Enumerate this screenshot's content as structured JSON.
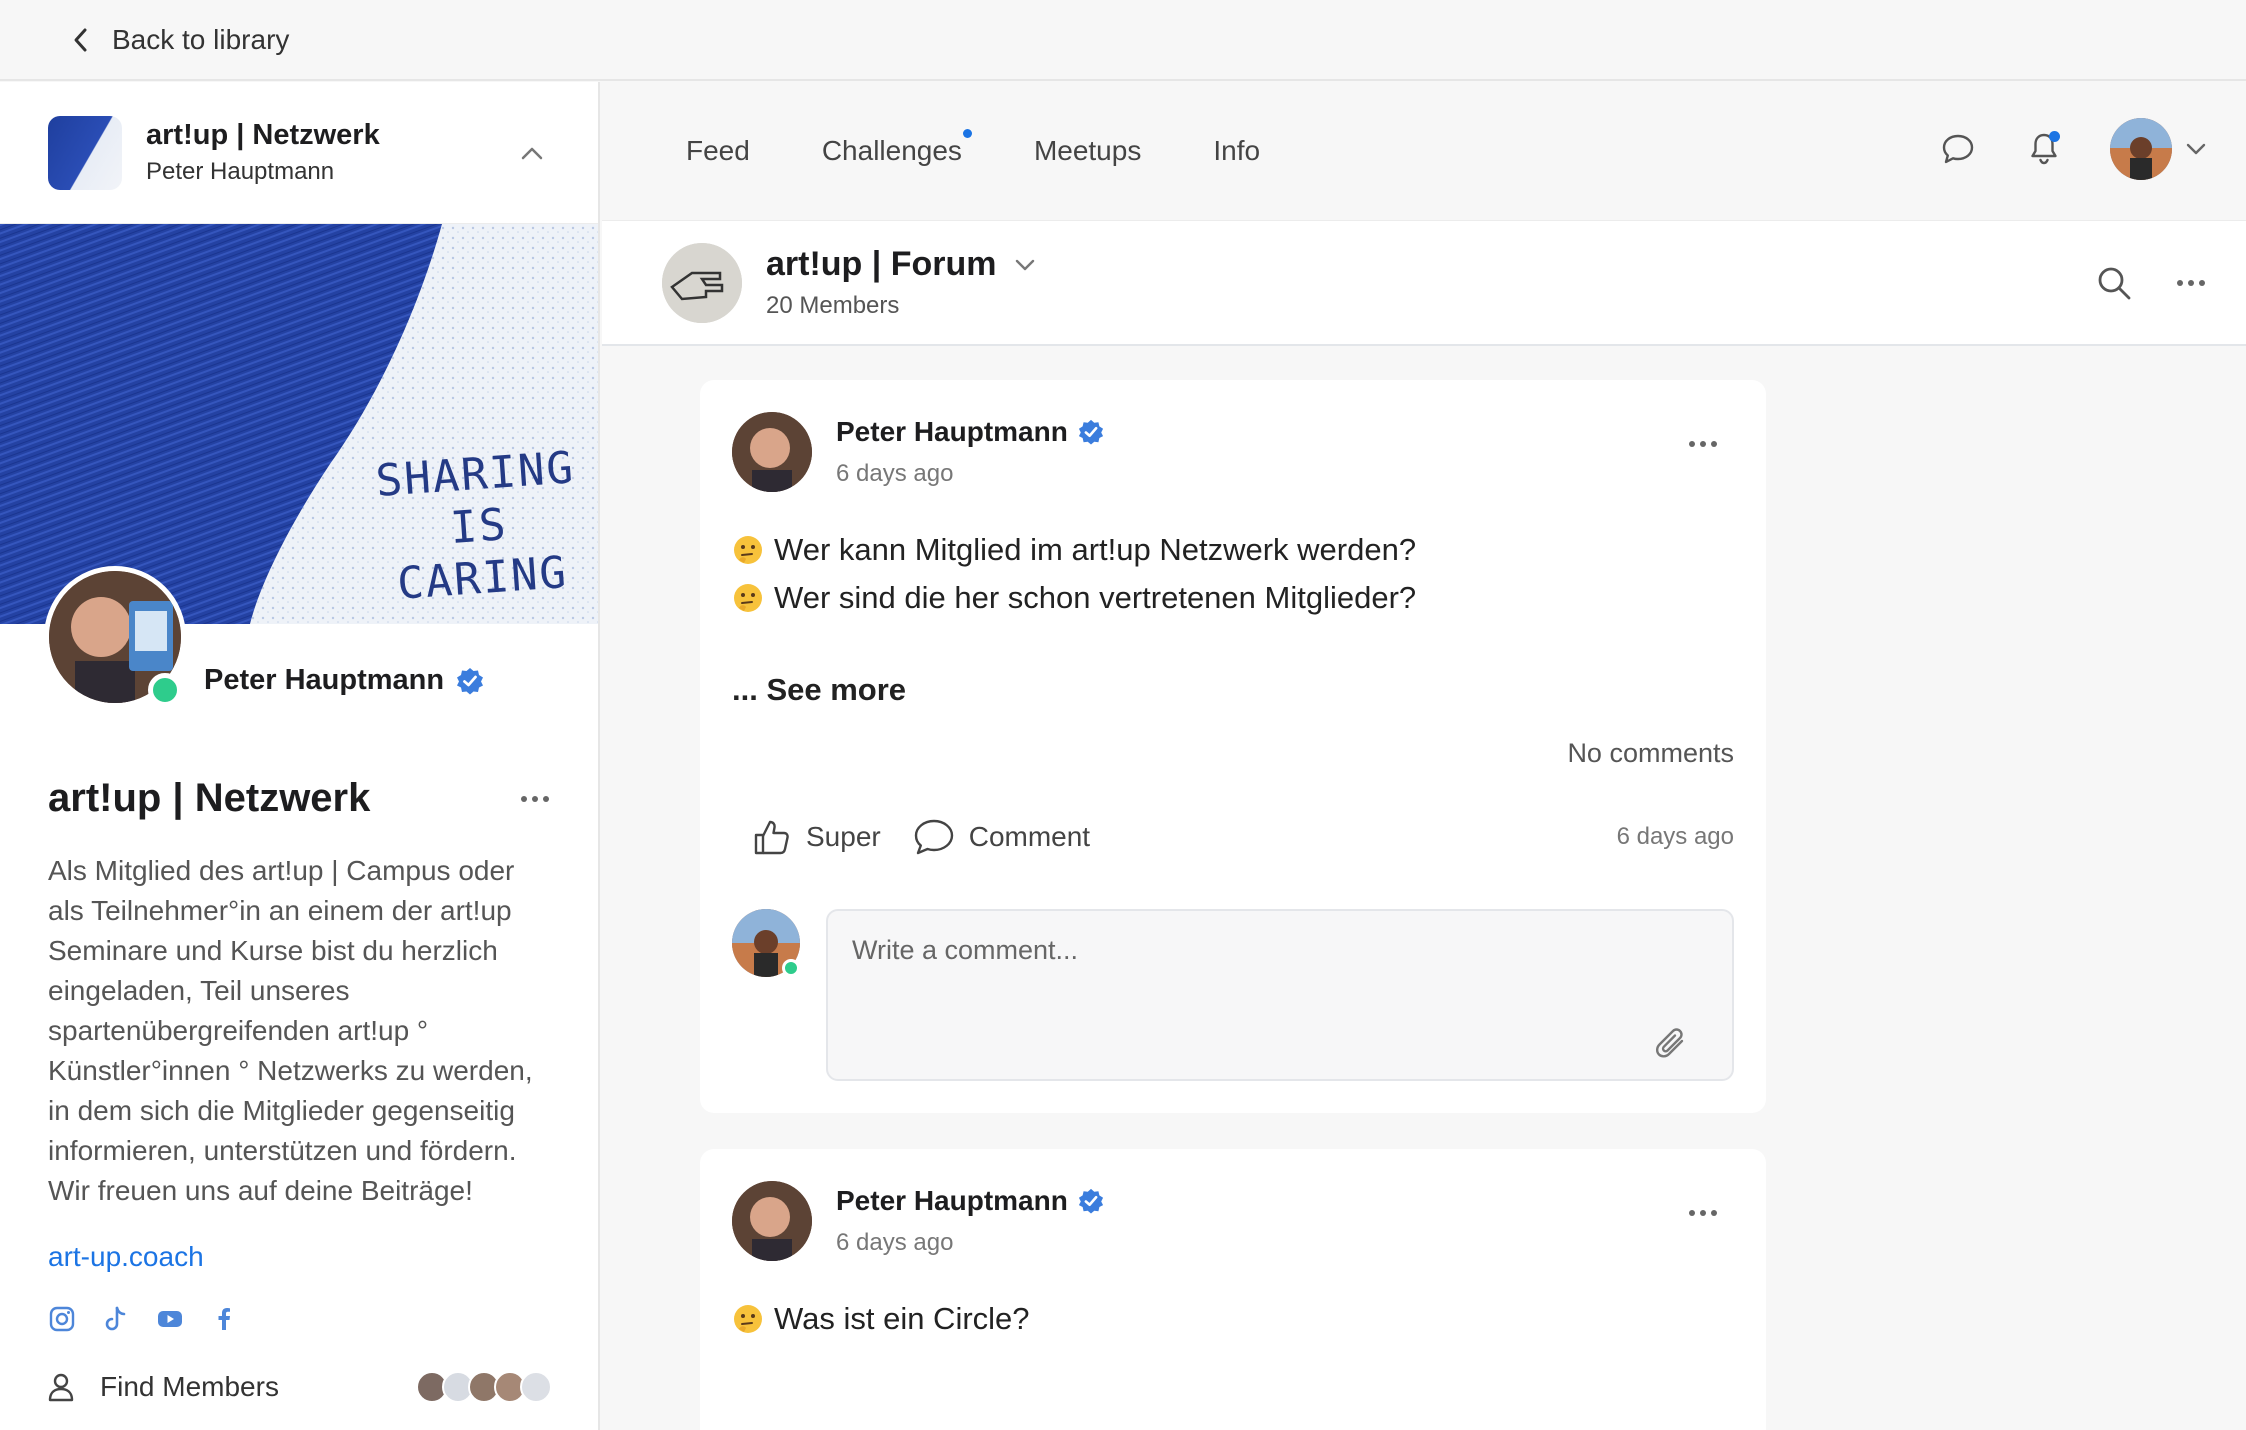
{
  "topbar": {
    "back_label": "Back to library"
  },
  "community": {
    "name": "art!up | Netzwerk",
    "owner": "Peter Hauptmann"
  },
  "cover": {
    "line1": "SHARING",
    "line2": "IS",
    "line3": "CARING"
  },
  "profile": {
    "name": "Peter Hauptmann"
  },
  "about": {
    "title": "art!up | Netzwerk",
    "description": "Als Mitglied des art!up | Campus oder als Teilnehmer°in an einem der art!up Seminare und Kurse bist du herzlich eingeladen, Teil unseres spartenübergreifenden art!up ° Künstler°innen ° Netzwerks zu werden, in dem sich die Mitglieder gegenseitig informieren, unterstützen und fördern. Wir freuen uns auf deine Beiträge!",
    "link": "art-up.coach"
  },
  "sidebar": {
    "find_members": "Find Members"
  },
  "nav": {
    "tabs": [
      "Feed",
      "Challenges",
      "Meetups",
      "Info"
    ]
  },
  "space": {
    "title": "art!up | Forum",
    "members": "20 Members"
  },
  "posts": [
    {
      "author": "Peter Hauptmann",
      "time": "6 days ago",
      "lines": [
        "Wer kann Mitglied im art!up Netzwerk werden?",
        "Wer sind die her schon vertretenen Mitglieder?"
      ],
      "see_more": "... See more",
      "comments": "No comments",
      "like_label": "Super",
      "comment_label": "Comment",
      "action_time": "6 days ago",
      "comment_placeholder": "Write a comment..."
    },
    {
      "author": "Peter Hauptmann",
      "time": "6 days ago",
      "lines": [
        "Was ist ein Circle?"
      ]
    }
  ],
  "colors": {
    "accent": "#1b74e4",
    "online": "#2ecc8c",
    "cover_blue": "#2442a3"
  }
}
